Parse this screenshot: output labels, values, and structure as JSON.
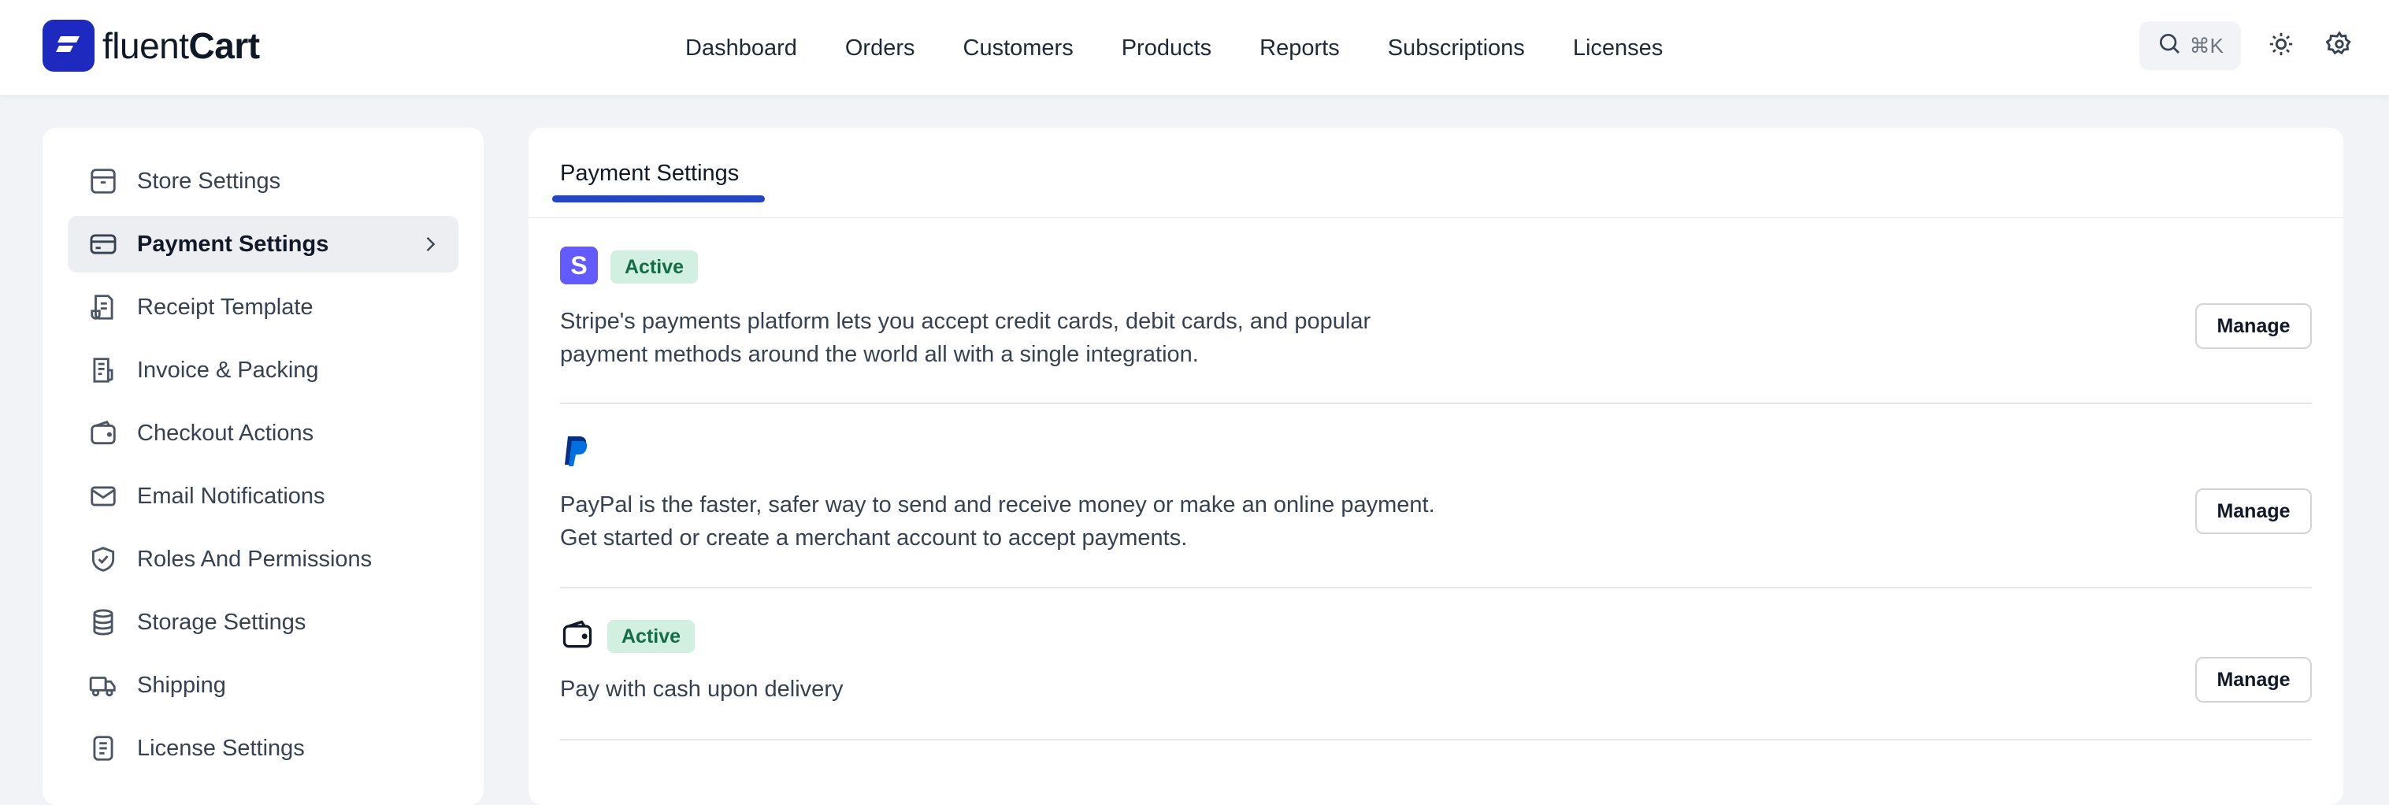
{
  "brand": {
    "name_light": "fluent",
    "name_bold": "Cart"
  },
  "nav": [
    "Dashboard",
    "Orders",
    "Customers",
    "Products",
    "Reports",
    "Subscriptions",
    "Licenses"
  ],
  "search": {
    "shortcut": "⌘K"
  },
  "sidebar": {
    "items": [
      {
        "label": "Store Settings",
        "icon": "store-icon"
      },
      {
        "label": "Payment Settings",
        "icon": "credit-card-icon",
        "active": true
      },
      {
        "label": "Receipt Template",
        "icon": "receipt-icon"
      },
      {
        "label": "Invoice & Packing",
        "icon": "invoice-icon"
      },
      {
        "label": "Checkout Actions",
        "icon": "wallet-icon"
      },
      {
        "label": "Email Notifications",
        "icon": "mail-icon"
      },
      {
        "label": "Roles And Permissions",
        "icon": "shield-check-icon"
      },
      {
        "label": "Storage Settings",
        "icon": "database-icon"
      },
      {
        "label": "Shipping",
        "icon": "truck-icon"
      },
      {
        "label": "License Settings",
        "icon": "document-icon"
      }
    ]
  },
  "main": {
    "tab": "Payment Settings",
    "gateways": [
      {
        "icon": "stripe-icon",
        "badge": "Active",
        "desc_line1": "Stripe's payments platform lets you accept credit cards, debit cards, and popular",
        "desc_line2": "payment methods around the world all with a single integration.",
        "button": "Manage"
      },
      {
        "icon": "paypal-icon",
        "badge": "",
        "desc_line1": "PayPal is the faster, safer way to send and receive money or make an online payment.",
        "desc_line2": "Get started or create a merchant account to accept payments.",
        "button": "Manage"
      },
      {
        "icon": "wallet-icon",
        "badge": "Active",
        "desc_line1": "Pay with cash upon delivery",
        "desc_line2": "",
        "button": "Manage"
      }
    ]
  },
  "colors": {
    "brand": "#1e2abf",
    "tab_underline": "#2346c6",
    "active_badge_bg": "#d1f0e1",
    "active_badge_text": "#146c43"
  }
}
